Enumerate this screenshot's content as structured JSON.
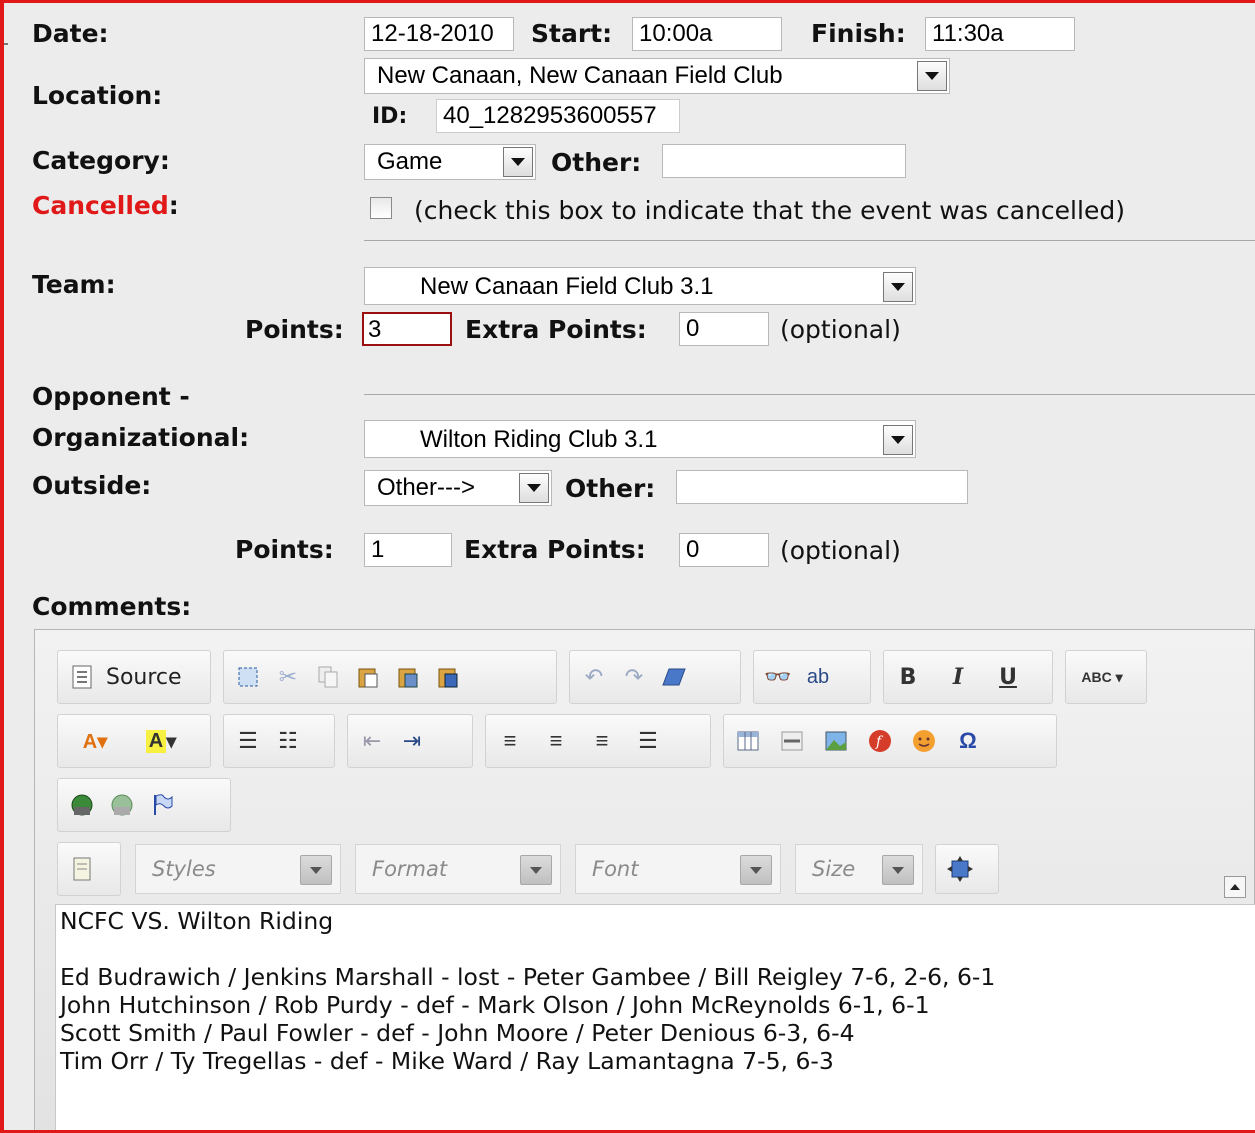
{
  "form": {
    "date_label": "Date:",
    "date_value": "12-18-2010",
    "start_label": "Start:",
    "start_value": "10:00a",
    "finish_label": "Finish:",
    "finish_value": "11:30a",
    "location_label": "Location:",
    "location_value": "New Canaan, New Canaan Field Club",
    "id_label": "ID:",
    "id_value": "40_1282953600557",
    "category_label": "Category:",
    "category_value": "Game",
    "category_other_label": "Other:",
    "category_other_value": "",
    "cancelled_label": "Cancelled",
    "cancelled_colon": ":",
    "cancelled_checked": false,
    "cancelled_hint": "(check this box to indicate that the event was cancelled)",
    "team_label": "Team:",
    "team_value": "New Canaan Field Club 3.1",
    "team_points_label": "Points:",
    "team_points_value": "3",
    "team_extra_label": "Extra Points:",
    "team_extra_value": "0",
    "team_optional": "(optional)",
    "opponent_label": "Opponent -",
    "organizational_label": "Organizational:",
    "organizational_value": "Wilton Riding Club 3.1",
    "outside_label": "Outside:",
    "outside_value": "Other--->",
    "outside_other_label": "Other:",
    "outside_other_value": "",
    "opp_points_label": "Points:",
    "opp_points_value": "1",
    "opp_extra_label": "Extra Points:",
    "opp_extra_value": "0",
    "opp_optional": "(optional)",
    "comments_label": "Comments:"
  },
  "editor": {
    "source_label": "Source",
    "combos": {
      "styles": "Styles",
      "format": "Format",
      "font": "Font",
      "size": "Size"
    },
    "content_lines": [
      "NCFC VS. Wilton Riding",
      "",
      "Ed Budrawich / Jenkins Marshall - lost - Peter Gambee / Bill Reigley 7-6, 2-6, 6-1",
      "John Hutchinson / Rob Purdy - def - Mark Olson / John McReynolds 6-1, 6-1",
      "Scott Smith / Paul Fowler - def - John Moore / Peter Denious 6-3, 6-4",
      "Tim Orr / Ty Tregellas - def - Mike Ward / Ray Lamantagna 7-5, 6-3"
    ]
  },
  "colors": {
    "frame_border": "#e01818",
    "cancelled_text": "#e01818",
    "panel_bg": "#ececec",
    "points_focus_border": "#9a1010"
  }
}
